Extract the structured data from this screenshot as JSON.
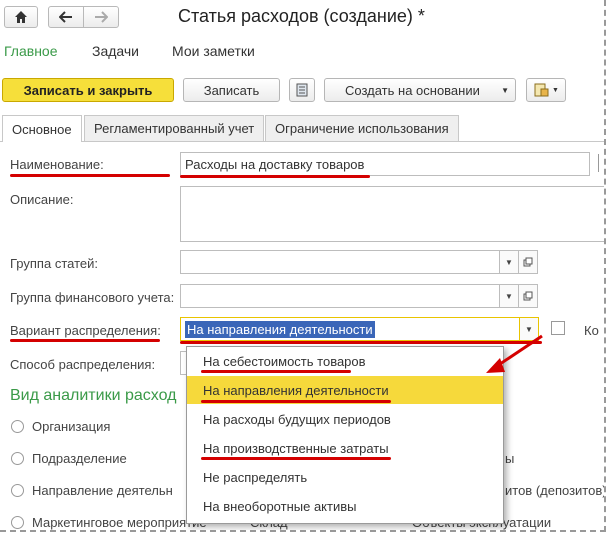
{
  "window": {
    "title": "Статья расходов (создание) *",
    "home_icon": "home-icon",
    "back_icon": "arrow-left-icon",
    "forward_icon": "arrow-right-icon"
  },
  "menu": {
    "items": [
      "Главное",
      "Задачи",
      "Мои заметки"
    ],
    "active_color": "#3a9a48"
  },
  "toolbar": {
    "save_close": "Записать и закрыть",
    "save": "Записать",
    "create_based": "Создать на основании",
    "list_icon": "list-icon",
    "report_icon": "report-icon"
  },
  "tabs": [
    "Основное",
    "Регламентированный учет",
    "Ограничение использования"
  ],
  "form": {
    "name_label": "Наименование:",
    "name_value": "Расходы на доставку товаров",
    "description_label": "Описание:",
    "group_label": "Группа статей:",
    "fin_group_label": "Группа финансового учета:",
    "distribution_label": "Вариант распределения:",
    "distribution_value": "На направления деятельности",
    "method_label": "Способ распределения:",
    "right_checkbox_label": "Ко"
  },
  "analytics": {
    "section_title": "Вид аналитики расход",
    "radios": [
      "Организация",
      "Подразделение",
      "Направление деятельн",
      "Маркетинговое мероприятие"
    ],
    "partial_right_1": "ы",
    "partial_right_2": "итов (депозитов)",
    "partial_bottom_1": "Склад",
    "partial_bottom_2": "Объекты эксплуатации"
  },
  "dropdown": {
    "options": [
      "На себестоимость товаров",
      "На направления деятельности",
      "На расходы будущих периодов",
      "На производственные затраты",
      "Не распределять",
      "На внеоборотные активы"
    ],
    "selected_index": 1,
    "highlight_color": "#f6d93b"
  },
  "annotations": {
    "color": "#d40000"
  }
}
